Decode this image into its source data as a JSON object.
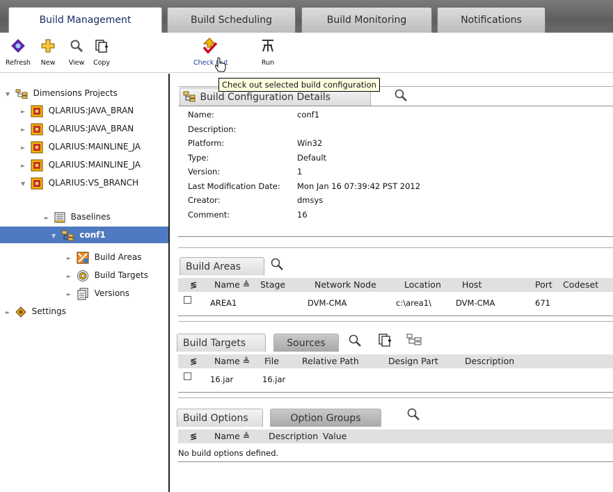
{
  "tabs": [
    "Build Management",
    "Build Scheduling",
    "Build Monitoring",
    "Notifications"
  ],
  "toolbar": {
    "refresh": "Refresh",
    "new": "New",
    "view": "View",
    "copy": "Copy",
    "checkout": "Check Out",
    "run": "Run"
  },
  "tooltip": "Check out selected build configuration",
  "tree": {
    "root": "Dimensions Projects",
    "projects": [
      "QLARIUS:JAVA_BRAN",
      "QLARIUS:JAVA_BRAN",
      "QLARIUS:MAINLINE_JA",
      "QLARIUS:MAINLINE_JA",
      "QLARIUS:VS_BRANCH"
    ],
    "baselines": "Baselines",
    "selected": "conf1",
    "children": [
      "Build Areas",
      "Build Targets",
      "Versions"
    ],
    "settings": "Settings"
  },
  "details": {
    "tab": "Build Configuration Details",
    "fields": [
      {
        "k": "Name:",
        "v": "conf1"
      },
      {
        "k": "Description:",
        "v": ""
      },
      {
        "k": "Platform:",
        "v": "Win32"
      },
      {
        "k": "Type:",
        "v": "Default"
      },
      {
        "k": "Version:",
        "v": "1"
      },
      {
        "k": "Last Modification Date:",
        "v": "Mon Jan 16 07:39:42 PST 2012"
      },
      {
        "k": "Creator:",
        "v": "dmsys"
      },
      {
        "k": "Comment:",
        "v": "16"
      }
    ]
  },
  "areas": {
    "tab": "Build Areas",
    "cols": [
      "Name ≜",
      "Stage",
      "Network Node",
      "Location",
      "Host",
      "Port",
      "Codeset"
    ],
    "row": [
      "AREA1",
      "",
      "DVM-CMA",
      "c:\\area1\\",
      "DVM-CMA",
      "671",
      ""
    ]
  },
  "targets": {
    "tab1": "Build Targets",
    "tab2": "Sources",
    "cols": [
      "Name ≜",
      "File",
      "Relative Path",
      "Design Part",
      "Description"
    ],
    "row": [
      "16.jar",
      "16.jar"
    ]
  },
  "options": {
    "tab1": "Build Options",
    "tab2": "Option Groups",
    "cols": [
      "Name ≜",
      "Description",
      "Value"
    ],
    "empty": "No build options defined."
  }
}
